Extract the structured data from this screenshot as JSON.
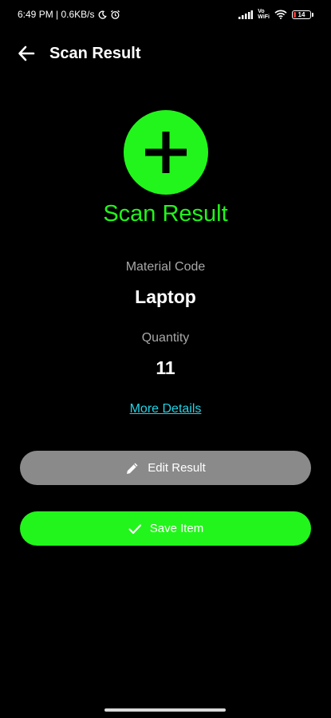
{
  "status_bar": {
    "time_network": "6:49 PM | 0.6KB/s",
    "volte_top": "Vo",
    "volte_bottom": "WiFi",
    "battery_level": "14",
    "battery_fraction": 0.14
  },
  "app_bar": {
    "title": "Scan Result",
    "back_icon": "arrow-left-icon"
  },
  "hero": {
    "icon": "plus-icon",
    "title": "Scan Result"
  },
  "fields": {
    "material_label": "Material Code",
    "material_value": "Laptop",
    "quantity_label": "Quantity",
    "quantity_value": "11"
  },
  "links": {
    "more_details": "More Details"
  },
  "buttons": {
    "edit_label": "Edit Result",
    "edit_icon": "pencil-icon",
    "save_label": "Save Item",
    "save_icon": "check-icon"
  },
  "colors": {
    "accent_green": "#22f51b",
    "link_cyan": "#22d3e6",
    "edit_button_gray": "#8a8a8a",
    "battery_red": "#e53935"
  }
}
